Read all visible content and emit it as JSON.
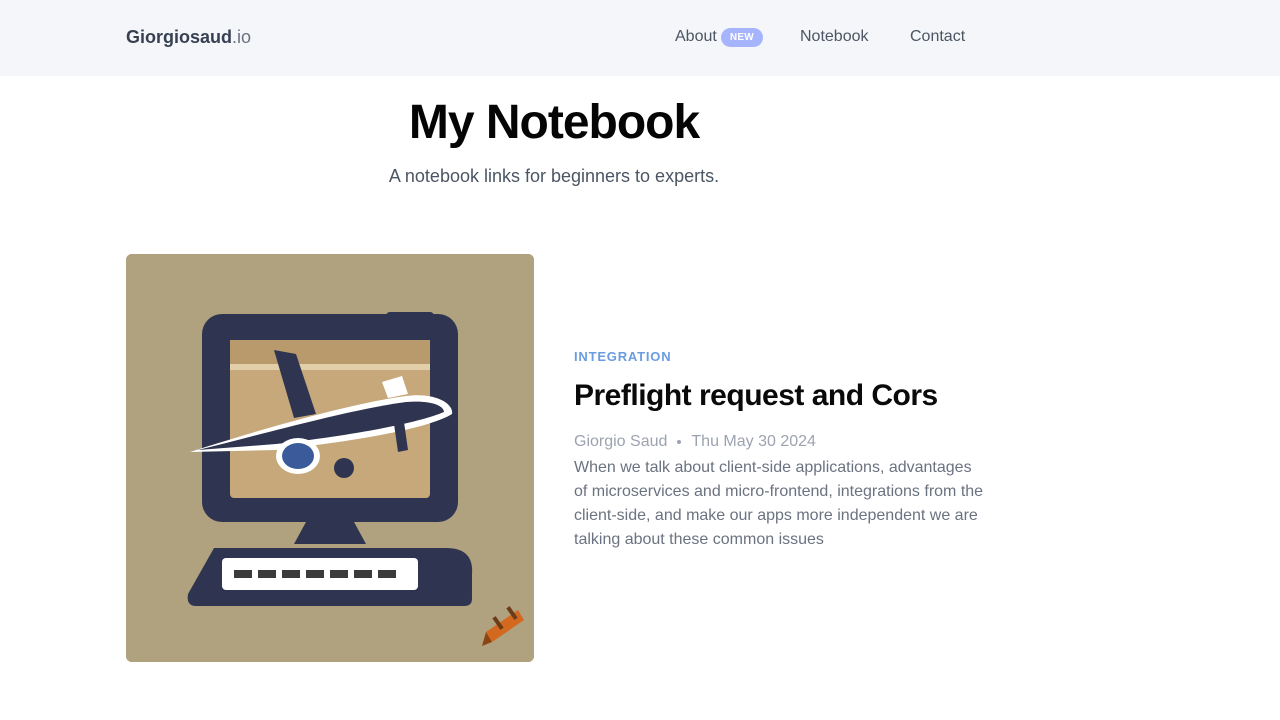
{
  "nav": {
    "brand_name": "Giorgiosaud",
    "brand_tld": ".io",
    "about_label": "About",
    "about_badge": "NEW",
    "notebook_label": "Notebook",
    "contact_label": "Contact"
  },
  "page": {
    "title": "My Notebook",
    "subtitle": "A notebook links for beginners to experts."
  },
  "post": {
    "category": "INTEGRATION",
    "title": "Preflight request and Cors",
    "author": "Giorgio Saud",
    "date": "Thu May 30 2024",
    "excerpt": "When we talk about client-side applications, advantages of microservices and micro-frontend, integrations from the client-side, and make our apps more independent we are talking about these common issues",
    "image_icon": "computer-airplane-illustration"
  },
  "colors": {
    "nav_bg": "#f4f6f9",
    "badge_bg": "#a5b4fc",
    "category": "#6b9be0",
    "image_bg": "#b0a17f"
  }
}
